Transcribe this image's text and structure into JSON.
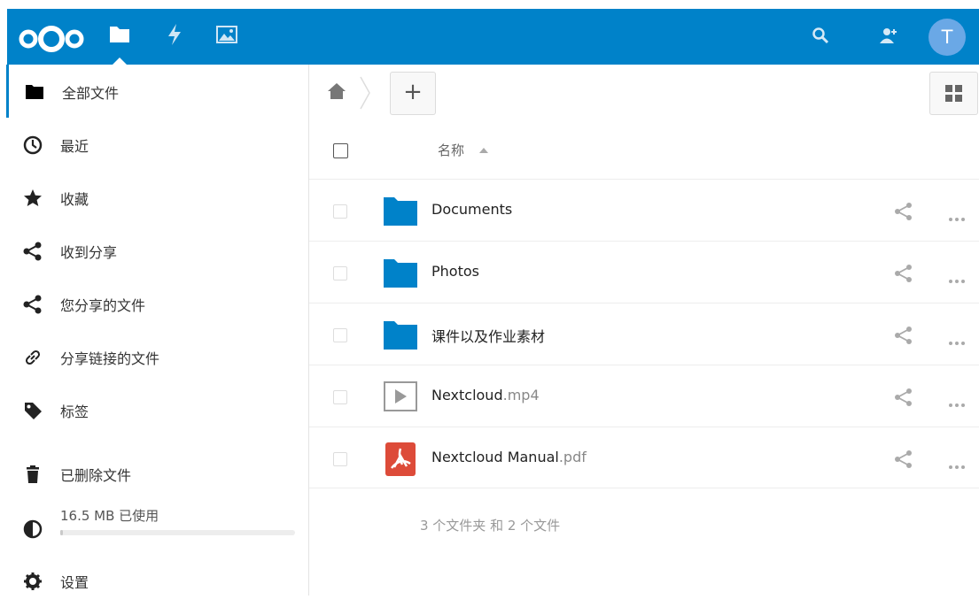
{
  "header": {
    "apps": [
      {
        "name": "files",
        "icon": "folder-icon"
      },
      {
        "name": "activity",
        "icon": "lightning-icon"
      },
      {
        "name": "gallery",
        "icon": "image-icon"
      }
    ],
    "avatar_initial": "T",
    "brand_color": "#0082c9"
  },
  "sidebar": {
    "items": [
      {
        "label": "全部文件",
        "icon": "folder-icon"
      },
      {
        "label": "最近",
        "icon": "clock-icon"
      },
      {
        "label": "收藏",
        "icon": "star-icon"
      },
      {
        "label": "收到分享",
        "icon": "share-icon"
      },
      {
        "label": "您分享的文件",
        "icon": "share-icon"
      },
      {
        "label": "分享链接的文件",
        "icon": "link-icon"
      },
      {
        "label": "标签",
        "icon": "tag-icon"
      },
      {
        "label": "已删除文件",
        "icon": "trash-icon"
      }
    ],
    "quota": {
      "label": "16.5 MB 已使用",
      "fraction": 0.01
    },
    "settings_label": "设置"
  },
  "main": {
    "add_label": "+",
    "column_name": "名称",
    "files": [
      {
        "name": "Documents",
        "ext": "",
        "type": "folder"
      },
      {
        "name": "Photos",
        "ext": "",
        "type": "folder"
      },
      {
        "name": "课件以及作业素材",
        "ext": "",
        "type": "folder"
      },
      {
        "name": "Nextcloud",
        "ext": ".mp4",
        "type": "video"
      },
      {
        "name": "Nextcloud Manual",
        "ext": ".pdf",
        "type": "pdf"
      }
    ],
    "summary": "3 个文件夹 和 2 个文件"
  }
}
